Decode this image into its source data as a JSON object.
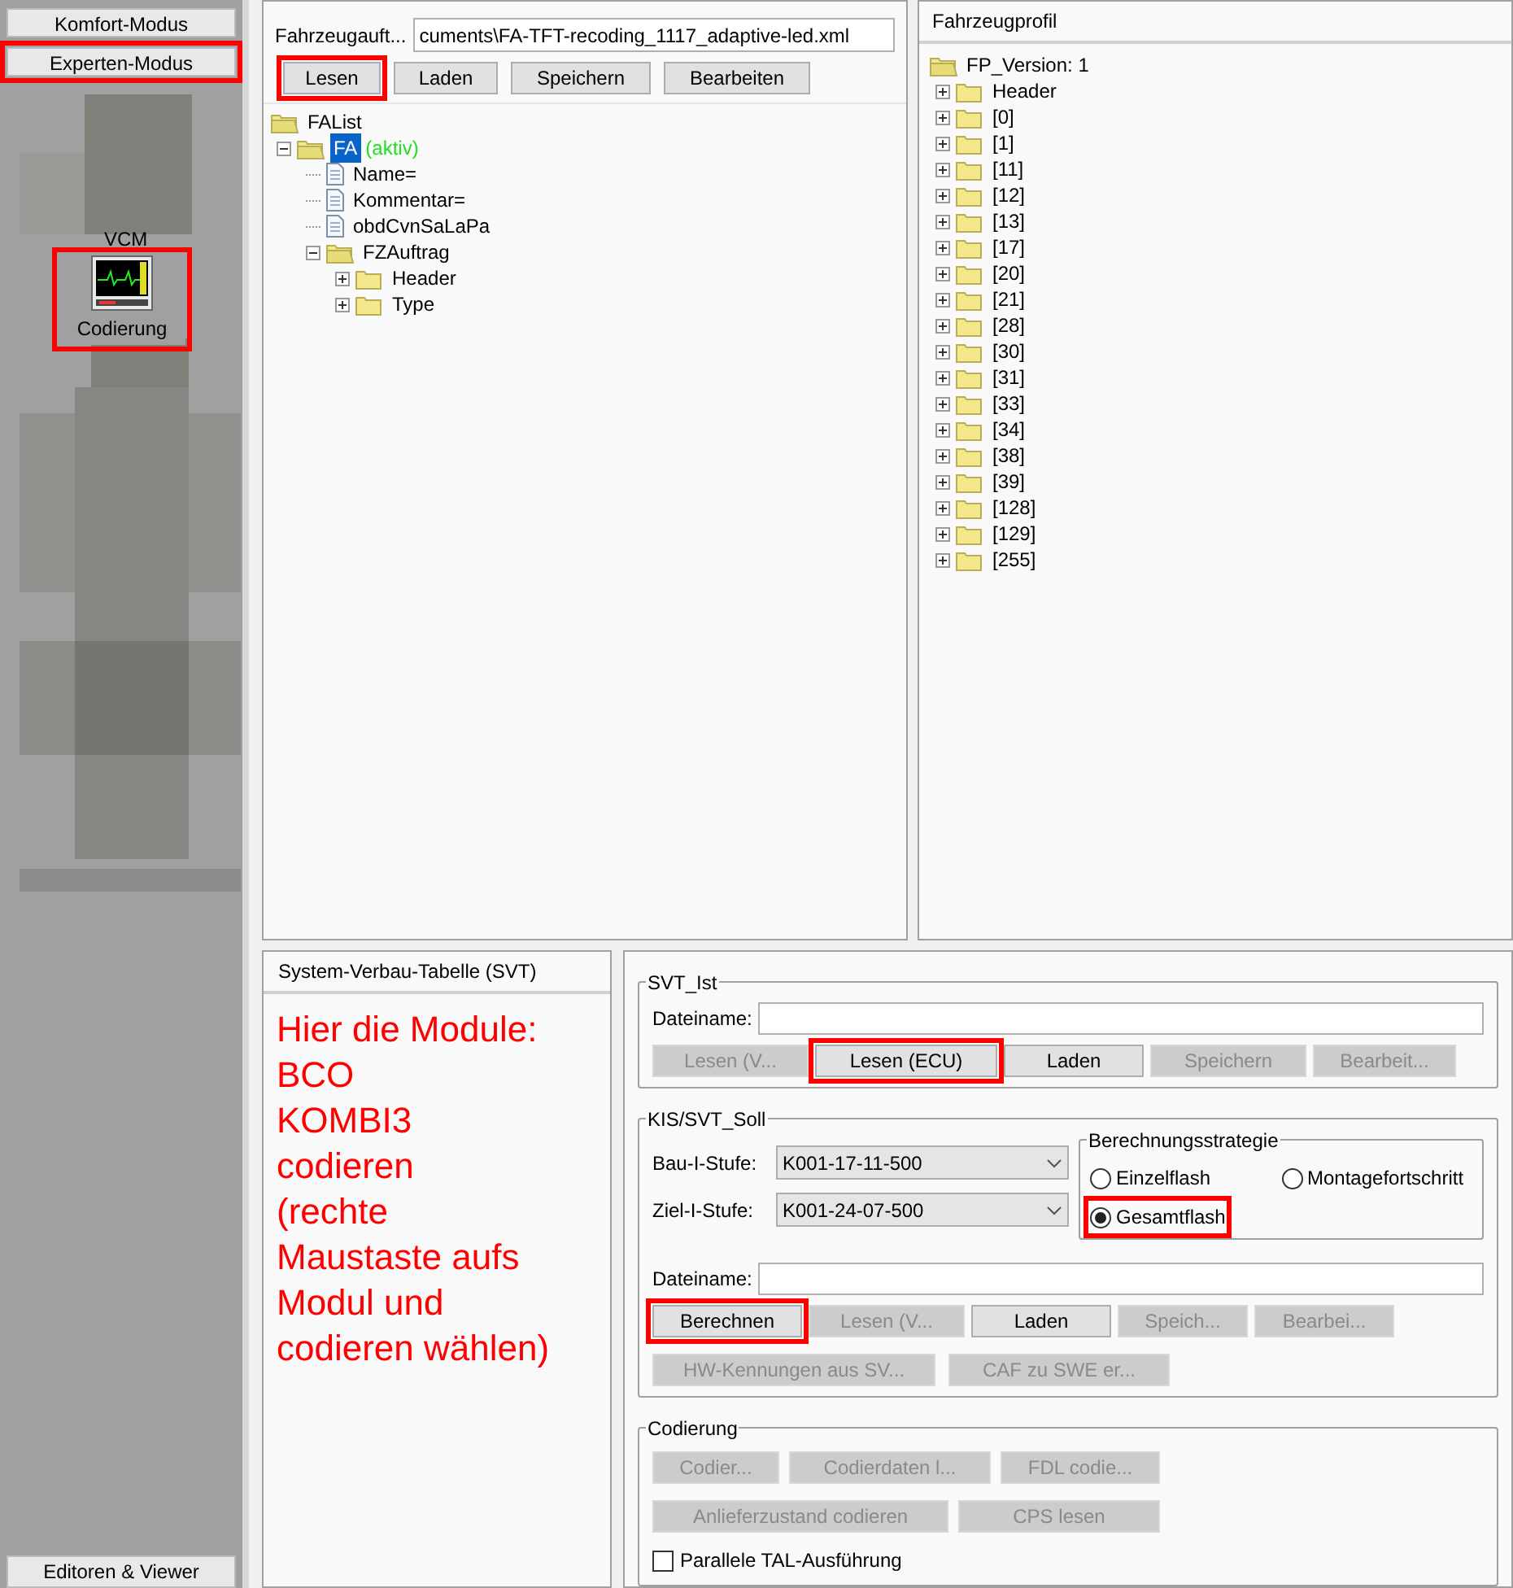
{
  "sidebar": {
    "buttons": [
      {
        "label": "Komfort-Modus",
        "highlighted": false
      },
      {
        "label": "Experten-Modus",
        "highlighted": true
      }
    ],
    "module_label": "VCM",
    "tool": {
      "label": "Codierung",
      "highlighted": true
    },
    "bottom_button": "Editoren & Viewer"
  },
  "fa_panel": {
    "file_label": "Fahrzeugauft...",
    "file_value": "cuments\\FA-TFT-recoding_1117_adaptive-led.xml",
    "buttons": [
      {
        "label": "Lesen",
        "highlighted": true
      },
      {
        "label": "Laden",
        "highlighted": false
      },
      {
        "label": "Speichern",
        "highlighted": false
      },
      {
        "label": "Bearbeiten",
        "highlighted": false
      }
    ],
    "tree": [
      {
        "label": "FAList",
        "kind": "root",
        "children": [
          {
            "label": "FA",
            "suffix": "(aktiv)",
            "kind": "folder",
            "expanded": true,
            "selected": true,
            "children": [
              {
                "label": "Name=",
                "kind": "file"
              },
              {
                "label": "Kommentar=",
                "kind": "file"
              },
              {
                "label": "obdCvnSaLaPa",
                "kind": "file"
              },
              {
                "label": "FZAuftrag",
                "kind": "folder",
                "expanded": true,
                "selected": false,
                "children": [
                  {
                    "label": "Header",
                    "kind": "folder",
                    "expanded": false,
                    "selected": false
                  },
                  {
                    "label": "Type",
                    "kind": "folder",
                    "expanded": false,
                    "selected": false
                  }
                ]
              }
            ]
          }
        ]
      }
    ]
  },
  "profile_panel": {
    "title": "Fahrzeugprofil",
    "tree": [
      {
        "label": "FP_Version: 1",
        "kind": "root",
        "children": [
          {
            "label": "Header",
            "kind": "folder",
            "expanded": false,
            "selected": false
          },
          {
            "label": "[0]",
            "kind": "folder",
            "expanded": false,
            "selected": false
          },
          {
            "label": "[1]",
            "kind": "folder",
            "expanded": false,
            "selected": false
          },
          {
            "label": "[11]",
            "kind": "folder",
            "expanded": false,
            "selected": false
          },
          {
            "label": "[12]",
            "kind": "folder",
            "expanded": false,
            "selected": false
          },
          {
            "label": "[13]",
            "kind": "folder",
            "expanded": false,
            "selected": false
          },
          {
            "label": "[17]",
            "kind": "folder",
            "expanded": false,
            "selected": false
          },
          {
            "label": "[20]",
            "kind": "folder",
            "expanded": false,
            "selected": false
          },
          {
            "label": "[21]",
            "kind": "folder",
            "expanded": false,
            "selected": false
          },
          {
            "label": "[28]",
            "kind": "folder",
            "expanded": false,
            "selected": false
          },
          {
            "label": "[30]",
            "kind": "folder",
            "expanded": false,
            "selected": false
          },
          {
            "label": "[31]",
            "kind": "folder",
            "expanded": false,
            "selected": false
          },
          {
            "label": "[33]",
            "kind": "folder",
            "expanded": false,
            "selected": false
          },
          {
            "label": "[34]",
            "kind": "folder",
            "expanded": false,
            "selected": false
          },
          {
            "label": "[38]",
            "kind": "folder",
            "expanded": false,
            "selected": false
          },
          {
            "label": "[39]",
            "kind": "folder",
            "expanded": false,
            "selected": false
          },
          {
            "label": "[128]",
            "kind": "folder",
            "expanded": false,
            "selected": false
          },
          {
            "label": "[129]",
            "kind": "folder",
            "expanded": false,
            "selected": false
          },
          {
            "label": "[255]",
            "kind": "folder",
            "expanded": false,
            "selected": false
          }
        ]
      }
    ]
  },
  "svt_panel": {
    "title": "System-Verbau-Tabelle (SVT)",
    "note": "Hier die Module:\nBCO\nKOMBI3\ncodieren\n(rechte\nMaustaste aufs\nModul und\ncodieren wählen)"
  },
  "svt_ist": {
    "title": "SVT_Ist",
    "file_label": "Dateiname:",
    "buttons": [
      {
        "label": "Lesen (V...",
        "disabled": true,
        "highlighted": false
      },
      {
        "label": "Lesen (ECU)",
        "disabled": false,
        "highlighted": true
      },
      {
        "label": "Laden",
        "disabled": false,
        "highlighted": false
      },
      {
        "label": "Speichern",
        "disabled": true,
        "highlighted": false
      },
      {
        "label": "Bearbeit...",
        "disabled": true,
        "highlighted": false
      }
    ]
  },
  "svt_soll": {
    "title": "KIS/SVT_Soll",
    "selects": [
      {
        "label": "Bau-I-Stufe:",
        "value": "K001-17-11-500"
      },
      {
        "label": "Ziel-I-Stufe:",
        "value": "K001-24-07-500"
      }
    ],
    "strategy": {
      "title": "Berechnungsstrategie",
      "options": [
        {
          "label": "Einzelflash",
          "selected": false,
          "highlighted": false
        },
        {
          "label": "Montagefortschritt",
          "selected": false,
          "highlighted": false
        },
        {
          "label": "Gesamtflash",
          "selected": true,
          "highlighted": true
        }
      ]
    },
    "file_label": "Dateiname:",
    "buttons": [
      {
        "label": "Berechnen",
        "disabled": false,
        "highlighted": true
      },
      {
        "label": "Lesen (V...",
        "disabled": true,
        "highlighted": false
      },
      {
        "label": "Laden",
        "disabled": false,
        "highlighted": false
      },
      {
        "label": "Speich...",
        "disabled": true,
        "highlighted": false
      },
      {
        "label": "Bearbei...",
        "disabled": true,
        "highlighted": false
      }
    ],
    "buttons_2": [
      {
        "label": "HW-Kennungen aus SV...",
        "disabled": true,
        "highlighted": false
      },
      {
        "label": "CAF zu SWE er...",
        "disabled": true,
        "highlighted": false
      }
    ]
  },
  "codierung": {
    "title": "Codierung",
    "buttons": [
      {
        "label": "Codier...",
        "disabled": true,
        "highlighted": false
      },
      {
        "label": "Codierdaten l...",
        "disabled": true,
        "highlighted": false
      },
      {
        "label": "FDL codie...",
        "disabled": true,
        "highlighted": false
      }
    ],
    "buttons_2": [
      {
        "label": "Anlieferzustand codieren",
        "disabled": true,
        "highlighted": false
      },
      {
        "label": "CPS lesen",
        "disabled": true,
        "highlighted": false
      }
    ],
    "checkbox": {
      "label": "Parallele TAL-Ausführung",
      "checked": false
    }
  }
}
